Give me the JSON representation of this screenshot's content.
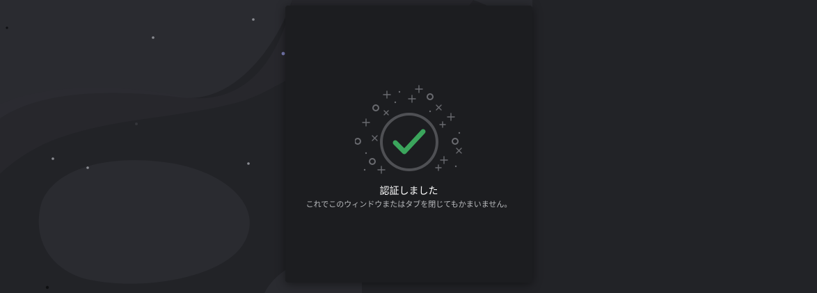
{
  "auth": {
    "title": "認証しました",
    "message": "これでこのウィンドウまたはタブを閉じてもかまいません。"
  },
  "icons": {
    "success": "checkmark-circle-icon",
    "decoration": "sparkles-icon"
  },
  "colors": {
    "background": "#222327",
    "card": "#1c1d20",
    "accent": "#3ba55c",
    "ring": "#4f5054"
  }
}
